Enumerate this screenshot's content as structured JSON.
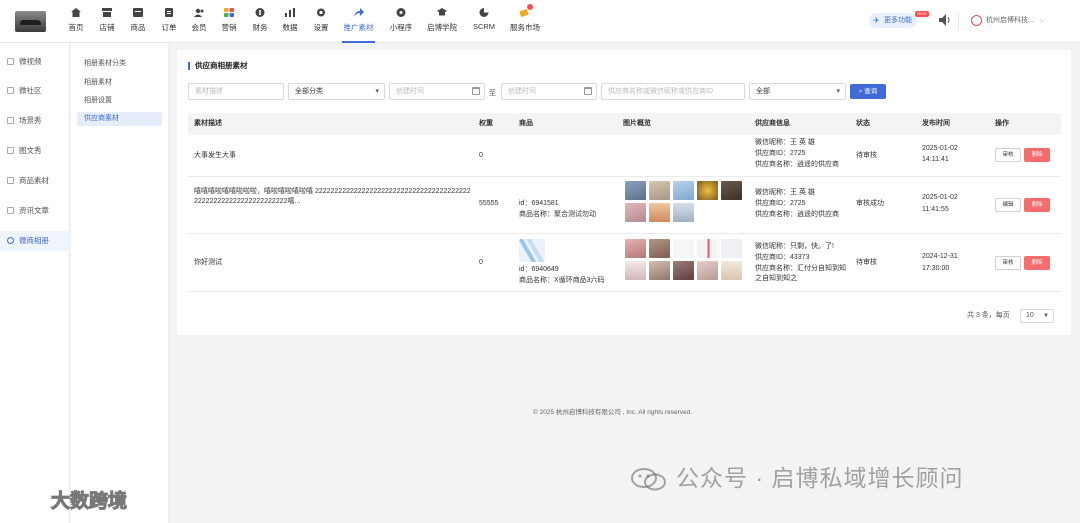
{
  "topnav": {
    "items": [
      {
        "label": "首页",
        "icon": "home-icon"
      },
      {
        "label": "店铺",
        "icon": "store-icon"
      },
      {
        "label": "商品",
        "icon": "goods-icon"
      },
      {
        "label": "订单",
        "icon": "order-icon"
      },
      {
        "label": "会员",
        "icon": "member-icon"
      },
      {
        "label": "营销",
        "icon": "marketing-icon"
      },
      {
        "label": "财务",
        "icon": "finance-icon"
      },
      {
        "label": "数据",
        "icon": "data-icon"
      },
      {
        "label": "设置",
        "icon": "settings-icon"
      },
      {
        "label": "推广素材",
        "icon": "share-icon"
      },
      {
        "label": "小程序",
        "icon": "miniprogram-icon"
      },
      {
        "label": "启博学院",
        "icon": "academy-icon"
      },
      {
        "label": "SCRM",
        "icon": "scrm-icon"
      },
      {
        "label": "服务市场",
        "icon": "market-icon"
      }
    ],
    "active_label": "推广素材",
    "more_label": "更多功能",
    "new_tag": "NEW",
    "company": "杭州启博科技..."
  },
  "leftnav": {
    "items": [
      {
        "label": "微视频",
        "active": false
      },
      {
        "label": "微社区",
        "active": false
      },
      {
        "label": "场景秀",
        "active": false
      },
      {
        "label": "图文秀",
        "active": false
      },
      {
        "label": "商品素材",
        "active": false
      },
      {
        "label": "资讯文章",
        "active": false
      },
      {
        "label": "微商相册",
        "active": true
      }
    ]
  },
  "subnav": {
    "items": [
      {
        "label": "相册素材分类",
        "active": false
      },
      {
        "label": "相册素材",
        "active": false
      },
      {
        "label": "相册设置",
        "active": false
      },
      {
        "label": "供应商素材",
        "active": true
      }
    ]
  },
  "page": {
    "title": "供应商相册素材"
  },
  "filters": {
    "desc_placeholder": "素材描述",
    "category_value": "全部分类",
    "start_placeholder": "创建时间",
    "to_label": "至",
    "end_placeholder": "创建时间",
    "supplier_placeholder": "供应商名称或微信昵称或供应商ID",
    "status_value": "全部",
    "search_label": "查询"
  },
  "table": {
    "headers": [
      "素材描述",
      "权重",
      "商品",
      "图片概览",
      "供应商信息",
      "状态",
      "发布时间",
      "操作"
    ],
    "audit_label": "审核",
    "delete_label": "删除",
    "rows": [
      {
        "desc": "大事发生大事",
        "weight": "0",
        "product_id": "",
        "product_name": "",
        "supplier_nick": "微信昵称：王 英 雄",
        "supplier_id": "供应商ID：2725",
        "supplier_name": "供应商名称：逍遥的供应商",
        "status": "待审核",
        "publish_date": "2025-01-02",
        "publish_time": "14:11:41",
        "thumbs": []
      },
      {
        "desc": "嘻嘻嘻啦嘻嘻啦啦啦，嘻啦嘻啦嘻啦嘻 2222222222222222222222222222222222222222222222222222222222222222嘻...",
        "weight": "55555",
        "product_id": "id：6941581",
        "product_name": "商品名称：聚合测试勿动",
        "supplier_nick": "微信昵称：王 英 雄",
        "supplier_id": "供应商ID：2725",
        "supplier_name": "供应商名称：逍遥的供应商",
        "status": "审核成功",
        "publish_date": "2025-01-02",
        "publish_time": "11:41:55",
        "thumbs": [
          "#7c8fa6",
          "#c9b9a8",
          "#9fbcd8",
          "#c69c3b",
          "#5b4a3e",
          "#d8a3a9",
          "#e7b08a",
          "#b9c7d6"
        ]
      },
      {
        "desc": "你好测试",
        "weight": "0",
        "product_id": "id：6940649",
        "product_name": "商品名称：X循环商品3六码",
        "supplier_nick": "微信昵称：只剩，快。了!",
        "supplier_id": "供应商ID：43373",
        "supplier_name": "供应商名称：汇付分自知到知之自知到知之",
        "status": "待审核",
        "publish_date": "2024-12-31",
        "publish_time": "17:30:00",
        "thumbs": [
          "#d7a6a6",
          "#9e7e6e",
          "#f4f4f4",
          "#eef0f4",
          "#f0e6e6",
          "#c7b3a7",
          "#8a6a6a",
          "#dcc4c0",
          "#eadfd2",
          "#f1eded"
        ]
      }
    ]
  },
  "pagination": {
    "summary": "共 3 条，每页",
    "page_size": "10"
  },
  "footer": {
    "copyright": "© 2025 杭州启博科技有限公司 , Inc. All rights reserved."
  },
  "watermarks": {
    "right": "公众号 · 启博私域增长顾问",
    "left": "大数跨境"
  },
  "colors": {
    "accent": "#3f6ad8",
    "danger": "#f56c6c"
  }
}
